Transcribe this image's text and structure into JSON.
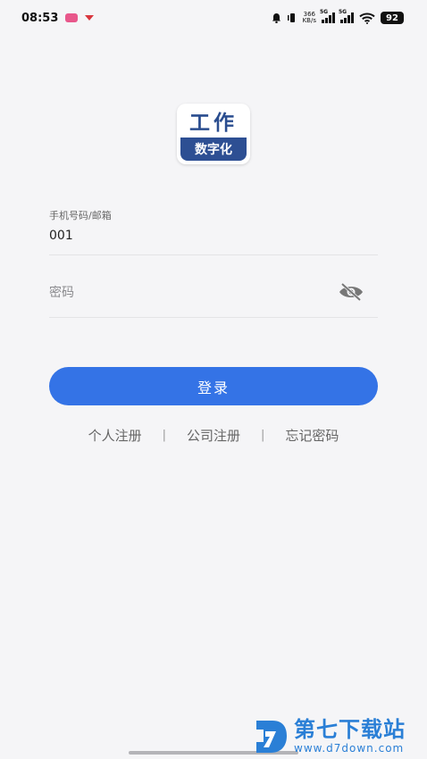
{
  "status_bar": {
    "time": "08:53",
    "net_speed_value": "366",
    "net_speed_unit": "KB/s",
    "sim1_label": "5G",
    "sim2_label": "5G",
    "battery": "92"
  },
  "logo": {
    "top_text": "工作",
    "bottom_text": "数字化"
  },
  "form": {
    "account_label": "手机号码/邮箱",
    "account_value": "001",
    "password_placeholder": "密码",
    "login_label": "登录"
  },
  "links": {
    "personal_register": "个人注册",
    "company_register": "公司注册",
    "forgot_password": "忘记密码",
    "separator": "|"
  },
  "watermark": {
    "title": "第七下载站",
    "url": "www.d7down.com"
  },
  "colors": {
    "accent": "#3473e6",
    "background": "#f5f5f7",
    "logo_blue": "#2d4f93"
  }
}
